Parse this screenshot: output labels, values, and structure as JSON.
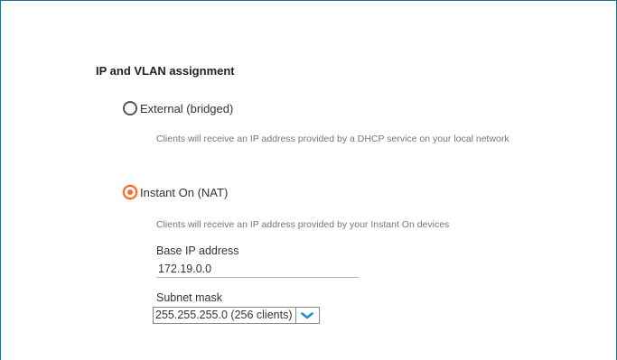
{
  "section": {
    "title": "IP and VLAN assignment"
  },
  "options": {
    "external": {
      "label": "External (bridged)",
      "description": "Clients will receive an IP address provided by a DHCP service on your local network",
      "selected": false
    },
    "nat": {
      "label": "Instant On (NAT)",
      "description": "Clients will receive an IP address provided by your Instant On devices",
      "selected": true
    }
  },
  "base_ip": {
    "label": "Base IP address",
    "value": "172.19.0.0"
  },
  "subnet": {
    "label": "Subnet mask",
    "selected": "255.255.255.0 (256 clients)"
  },
  "colors": {
    "accent": "#f36f21",
    "dropdown_icon": "#1a8fd6",
    "frame_border": "#1f6e8c"
  },
  "icons": {
    "dropdown": "chevron-down-icon"
  }
}
